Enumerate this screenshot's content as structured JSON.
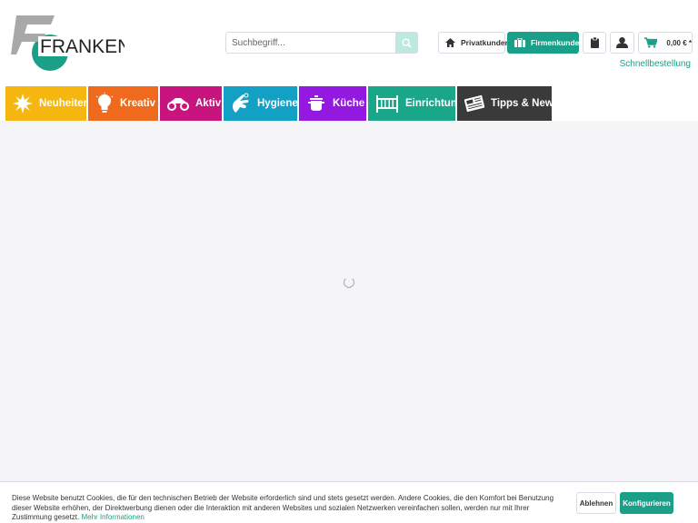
{
  "brand": {
    "name": "FRANKEN"
  },
  "search": {
    "placeholder": "Suchbegriff..."
  },
  "header": {
    "private_label": "Privatkunden",
    "business_label": "Firmenkunden",
    "cart_amount": "0,00 € *",
    "quick_order": "Schnellbestellung"
  },
  "nav": {
    "items": [
      {
        "label": "Neuheiten",
        "color": "#f5b60f",
        "icon": "sun-icon"
      },
      {
        "label": "Kreativ",
        "color": "#f06a1d",
        "icon": "lightbulb-icon"
      },
      {
        "label": "Aktiv",
        "color": "#c8147f",
        "icon": "quad-bike-icon"
      },
      {
        "label": "Hygiene",
        "color": "#13a0c5",
        "icon": "hand-wash-icon"
      },
      {
        "label": "Küche",
        "color": "#9419e0",
        "icon": "cooking-pot-icon"
      },
      {
        "label": "Einrichtung",
        "color": "#19a689",
        "icon": "crib-icon"
      },
      {
        "label": "Tipps & News",
        "color": "#3a3a3a",
        "icon": "newspaper-icon"
      }
    ]
  },
  "cookie": {
    "text": "Diese Website benutzt Cookies, die für den technischen Betrieb der Website erforderlich sind und stets gesetzt werden. Andere Cookies, die den Komfort bei Benutzung dieser Website erhöhen, der Direktwerbung dienen oder die Interaktion mit anderen Websites und sozialen Netzwerken vereinfachen sollen, werden nur mit Ihrer Zustimmung gesetzt.",
    "more_link": "Mehr Informationen",
    "decline": "Ablehnen",
    "configure": "Konfigurieren"
  },
  "colors": {
    "accent": "#1aa088",
    "content_bg": "#f5f5f8",
    "logo_grey": "#a8a8a8"
  }
}
